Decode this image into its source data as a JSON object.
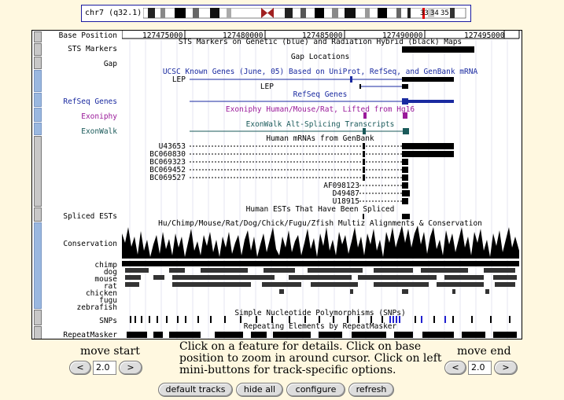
{
  "ideogram": {
    "chrom_label": "chr7 (q32.1)",
    "band_labels": [
      "33",
      "34",
      "35"
    ]
  },
  "ruler": {
    "label": "Base Position",
    "positions": [
      "127475000",
      "127480000",
      "127485000",
      "127490000",
      "127495000"
    ]
  },
  "tracks": {
    "sts": {
      "label": "STS Markers",
      "title": "STS Markers on Genetic (blue) and Radiation Hybrid (black) Maps"
    },
    "gap": {
      "label": "Gap",
      "title": "Gap Locations"
    },
    "known_genes": {
      "title": "UCSC Known Genes (June, 05) Based on UniProt, RefSeq, and GenBank mRNA",
      "genes": [
        "LEP",
        "LEP"
      ]
    },
    "refseq": {
      "label": "RefSeq Genes",
      "title": "RefSeq Genes"
    },
    "exoniphy": {
      "label": "Exoniphy",
      "title": "Exoniphy Human/Mouse/Rat, Lifted from Hg16"
    },
    "exonwalk": {
      "label": "ExonWalk",
      "title": "ExonWalk Alt-Splicing Transcripts"
    },
    "mrna": {
      "title": "Human mRNAs from GenBank",
      "items": [
        "U43653",
        "BC060830",
        "BC069323",
        "BC069452",
        "BC069527",
        "AF098123",
        "D49487",
        "U18915"
      ]
    },
    "spliced_ests": {
      "label": "Spliced ESTs",
      "title": "Human ESTs That Have Been Spliced"
    },
    "conservation": {
      "label": "Conservation",
      "title": "Hu/Chimp/Mouse/Rat/Dog/Chick/Fugu/Zfish Multiz Alignments & Conservation",
      "species": [
        "chimp",
        "dog",
        "mouse",
        "rat",
        "chicken",
        "fugu",
        "zebrafish"
      ]
    },
    "snps": {
      "label": "SNPs",
      "title": "Simple Nucleotide Polymorphisms (SNPs)"
    },
    "repeatmasker": {
      "label": "RepeatMasker",
      "title": "Repeating Elements by RepeatMasker"
    }
  },
  "controls": {
    "move_start": "move start",
    "move_end": "move end",
    "left_btn": "<",
    "right_btn": ">",
    "start_value": "2.0",
    "end_value": "2.0",
    "help_text": "Click on a feature for details. Click on base position to zoom in around cursor. Click on left mini-buttons for track-specific options.",
    "buttons": [
      "default tracks",
      "hide all",
      "configure",
      "refresh"
    ]
  },
  "colors": {
    "background": "#fff8e0",
    "blue_label": "#1a2aa0",
    "purple": "#9a1a9a",
    "teal": "#1a5a5a",
    "snp_blue": "#2020d0"
  }
}
